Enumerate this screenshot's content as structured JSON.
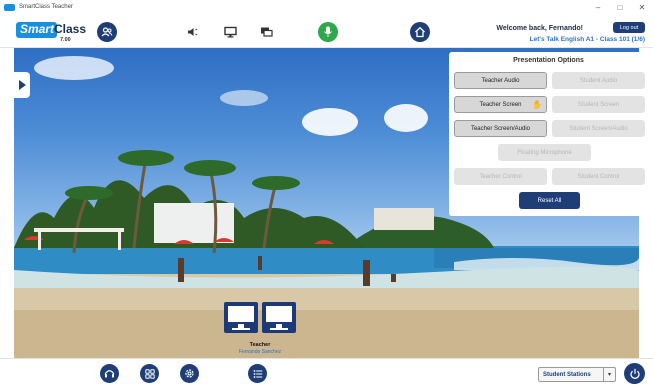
{
  "window": {
    "title": "SmartClass Teacher",
    "controls": {
      "minimize": "–",
      "maximize": "□",
      "close": "✕"
    }
  },
  "header": {
    "logo_smart": "Smart",
    "logo_class": "Class",
    "version": "7.00",
    "welcome": "Welcome back, Fernando!",
    "class_name": "Let's Talk English A1 - Class 101 (1/6)",
    "logout_label": "Log out",
    "icons": [
      "group-icon",
      "speaker-icon",
      "monitor-icon",
      "chat-icon",
      "microphone-icon",
      "home-icon"
    ]
  },
  "panel": {
    "title": "Presentation Options",
    "buttons": {
      "teacher_audio": "Teacher Audio",
      "student_audio": "Student Audio",
      "teacher_screen": "Teacher Screen",
      "student_screen": "Student Screen",
      "teacher_screen_audio": "Teacher Screen/Audio",
      "student_screen_audio": "Student Screen/Audio",
      "floating_microphone": "Floating Microphone",
      "teacher_control": "Teacher Control",
      "student_control": "Student Control",
      "reset_all": "Reset All"
    }
  },
  "teacher": {
    "label": "Teacher",
    "name": "Fernando Sanchez"
  },
  "footer": {
    "icons": [
      "headset-icon",
      "grid-icon",
      "settings-icon",
      "list-icon",
      "power-icon"
    ],
    "stations_label": "Student Stations",
    "stations_arrow": "▾"
  },
  "colors": {
    "navy": "#1f3e78",
    "brand_blue": "#1a8fe0",
    "link_blue": "#2b74c9",
    "mic_green": "#2ea84a"
  }
}
